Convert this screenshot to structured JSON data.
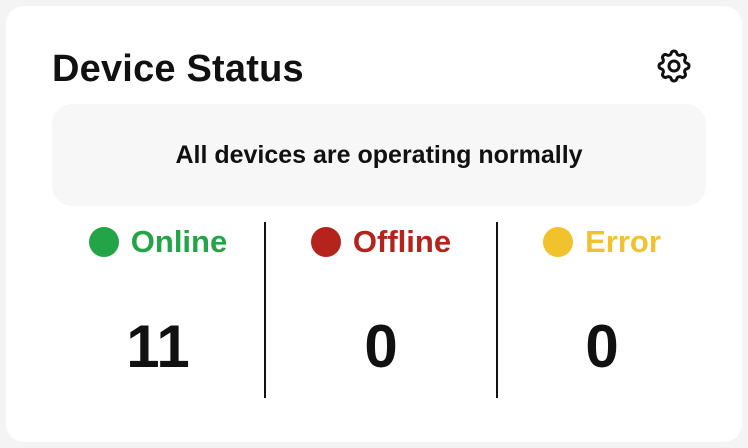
{
  "card": {
    "title": "Device Status",
    "settings_icon": "gear-icon",
    "banner_text": "All devices are operating normally"
  },
  "stats": [
    {
      "label": "Online",
      "value": "11",
      "color": "#22a447"
    },
    {
      "label": "Offline",
      "value": "0",
      "color": "#b5241c"
    },
    {
      "label": "Error",
      "value": "0",
      "color": "#f2c12e"
    }
  ]
}
